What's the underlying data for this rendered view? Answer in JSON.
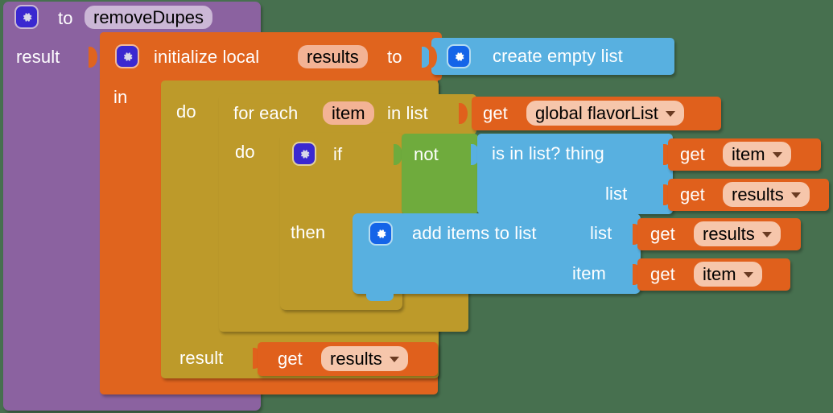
{
  "meta": {
    "workspace_background": "#47704f",
    "app": "MIT App Inventor Blocks Editor"
  },
  "procedure": {
    "kind": "procedure-do-result",
    "color": "#8b62a0",
    "gear_icon": "gear-icon",
    "to_label": "to",
    "name": "removeDupes",
    "result_label": "result"
  },
  "local": {
    "kind": "initialize-local-in-return",
    "color": "#e0641e",
    "gear_icon": "gear-icon",
    "init_label": "initialize local",
    "var_name": "results",
    "to_label": "to",
    "in_label": "in"
  },
  "create_empty_list": {
    "kind": "lists-create-empty",
    "color": "#58b0e0",
    "gear_icon": "gear-icon",
    "label": "create empty list"
  },
  "foreach": {
    "kind": "controls-forEach",
    "color": "#bd9a2a",
    "do_outer_label": "do",
    "for_each_label": "for each",
    "loop_var": "item",
    "in_list_label": "in list",
    "do_label": "do"
  },
  "get_global_flavorlist": {
    "kind": "lexical-variable-get",
    "color": "#e0601c",
    "get_label": "get",
    "value": "global flavorList",
    "dropdown_icon": "chevron-down-icon"
  },
  "if_block": {
    "kind": "controls-if",
    "color": "#bd9a2a",
    "gear_icon": "gear-icon",
    "if_label": "if",
    "then_label": "then"
  },
  "not_block": {
    "kind": "logic-negate",
    "color": "#6fab3d",
    "label": "not"
  },
  "is_in_list": {
    "kind": "lists-is-in",
    "color": "#58b0e0",
    "label": "is in list? thing",
    "list_label": "list"
  },
  "get_item_1": {
    "kind": "lexical-variable-get",
    "color": "#e0601c",
    "get_label": "get",
    "value": "item",
    "dropdown_icon": "chevron-down-icon"
  },
  "get_results_1": {
    "kind": "lexical-variable-get",
    "color": "#e0601c",
    "get_label": "get",
    "value": "results",
    "dropdown_icon": "chevron-down-icon"
  },
  "add_items_to_list": {
    "kind": "lists-add-items",
    "color": "#58b0e0",
    "gear_icon": "gear-icon",
    "label": "add items to list",
    "list_label": "list",
    "item_label": "item"
  },
  "get_results_2": {
    "kind": "lexical-variable-get",
    "color": "#e0601c",
    "get_label": "get",
    "value": "results",
    "dropdown_icon": "chevron-down-icon"
  },
  "get_item_2": {
    "kind": "lexical-variable-get",
    "color": "#e0601c",
    "get_label": "get",
    "value": "item",
    "dropdown_icon": "chevron-down-icon"
  },
  "result_row": {
    "result_label": "result"
  },
  "get_results_3": {
    "kind": "lexical-variable-get",
    "color": "#e0601c",
    "get_label": "get",
    "value": "results",
    "dropdown_icon": "chevron-down-icon"
  }
}
